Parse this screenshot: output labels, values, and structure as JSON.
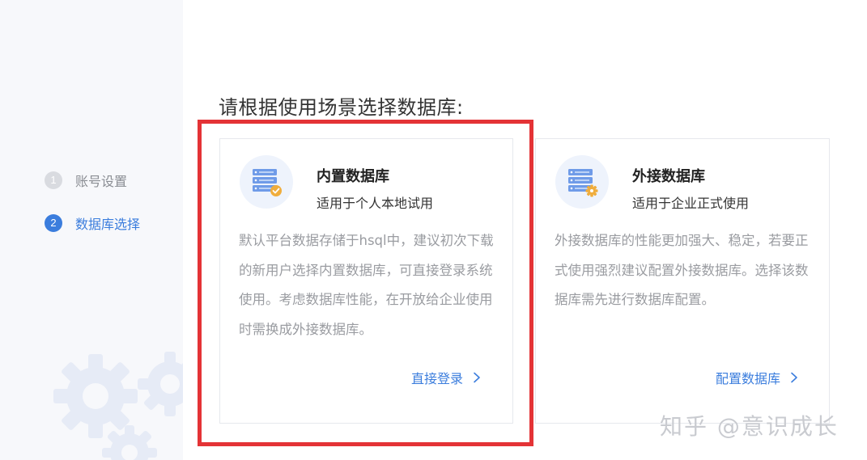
{
  "steps": [
    {
      "number": "1",
      "label": "账号设置"
    },
    {
      "number": "2",
      "label": "数据库选择"
    }
  ],
  "heading": "请根据使用场景选择数据库:",
  "cards": [
    {
      "title": "内置数据库",
      "subtitle": "适用于个人本地试用",
      "description": "默认平台数据存储于hsql中，建议初次下载的新用户选择内置数据库，可直接登录系统使用。考虑数据库性能，在开放给企业使用时需换成外接数据库。",
      "action": "直接登录",
      "icon": "database-check-icon"
    },
    {
      "title": "外接数据库",
      "subtitle": "适用于企业正式使用",
      "description": "外接数据库的性能更加强大、稳定，若要正式使用强烈建议配置外接数据库。选择该数据库需先进行数据库配置。",
      "action": "配置数据库",
      "icon": "database-gear-icon"
    }
  ],
  "watermark": "知乎 @意识成长",
  "colors": {
    "accent": "#3b7ddd",
    "highlight": "#e43336",
    "badge_check": "#f0ad3c"
  }
}
